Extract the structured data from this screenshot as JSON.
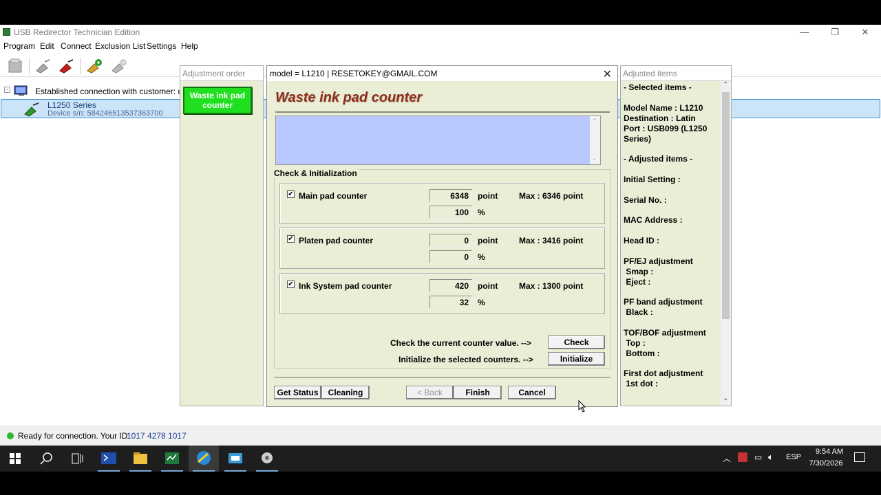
{
  "window": {
    "title": "USB Redirector Technician Edition",
    "controls": {
      "minimize": "—",
      "restore": "❐",
      "close": "✕"
    }
  },
  "menu": [
    "Program",
    "Edit",
    "Connect",
    "Exclusion List",
    "Settings",
    "Help"
  ],
  "tree": {
    "connection": "Established connection with customer: unai",
    "device_name": "L1250 Series",
    "device_serial": "Device s/n: 584246513537363700"
  },
  "status": {
    "text": "Ready for connection. Your ID:",
    "id": "1017 4278 1017",
    "indicator_color": "#2eb82e"
  },
  "adjustment_order": {
    "header": "Adjustment order",
    "item": "Waste ink pad counter"
  },
  "dialog": {
    "header": "model = L1210 | RESETOKEY@GMAIL.COM",
    "title": "Waste ink pad counter",
    "group_label": "Check & Initialization",
    "counters": [
      {
        "label": "Main pad counter",
        "point": "6348",
        "percent": "100",
        "max": "Max : 6346 point",
        "checked": "✔"
      },
      {
        "label": "Platen pad counter",
        "point": "0",
        "percent": "0",
        "max": "Max : 3416 point",
        "checked": "✔"
      },
      {
        "label": "Ink System pad counter",
        "point": "420",
        "percent": "32",
        "max": "Max : 1300 point",
        "checked": "✔"
      }
    ],
    "unit_point": "point",
    "unit_percent": "%",
    "check_prompt": "Check the current counter value. -->",
    "check_button": "Check",
    "init_prompt": "Initialize the selected counters. -->",
    "init_button": "Initialize",
    "buttons": {
      "get_status": "Get Status",
      "cleaning": "Cleaning",
      "back": "< Back",
      "finish": "Finish",
      "cancel": "Cancel"
    }
  },
  "adjusted_items": {
    "header": "Adjusted items",
    "lines": [
      "- Selected items -",
      "Model Name : L1210",
      "Destination : Latin",
      "Port : USB099 (L1250",
      "Series)",
      "- Adjusted items -",
      "Initial Setting :",
      "Serial No. :",
      "MAC Address :",
      "Head ID :",
      "PF/EJ adjustment",
      " Smap :",
      " Eject :",
      "PF band adjustment",
      " Black :",
      "TOF/BOF adjustment",
      " Top :",
      " Bottom :",
      "First dot adjustment",
      " 1st dot :"
    ]
  },
  "taskbar": {
    "time": "9:54 AM",
    "date": "7/30/2026",
    "language": "ESP"
  }
}
